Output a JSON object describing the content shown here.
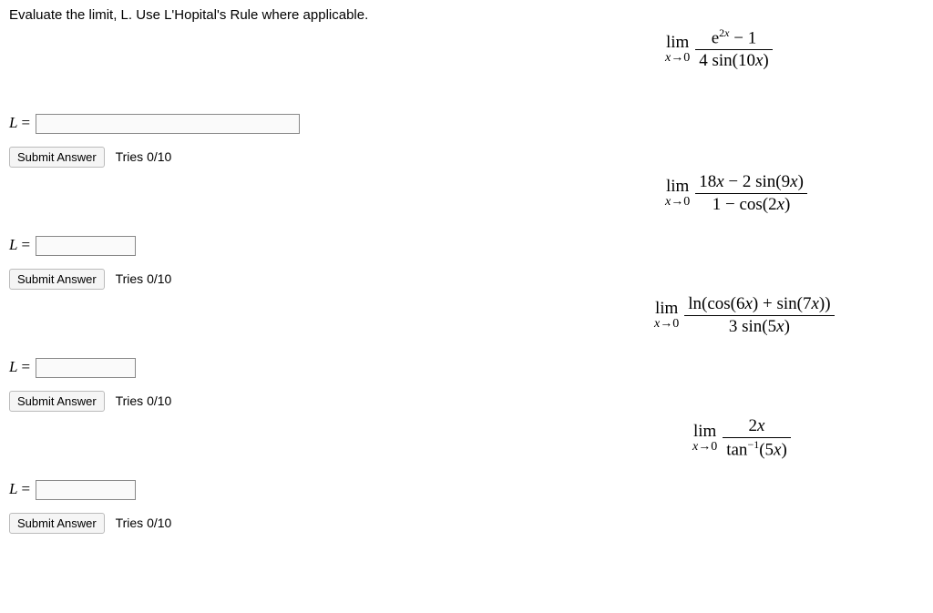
{
  "prompt": "Evaluate the limit, L. Use L'Hopital's Rule where applicable.",
  "label_L": "L",
  "label_eq": "=",
  "submit_label": "Submit Answer",
  "tries_label": "Tries 0/10",
  "lim_text": "lim",
  "approach": "x→0",
  "p1": {
    "num_html": "e<span class='sup'>2<span class='it'>x</span></span> − 1",
    "den_html": "4 sin(10<span class='it'>x</span>)",
    "input_width": 290
  },
  "p2": {
    "num_html": "18<span class='it'>x</span> − 2 sin(9<span class='it'>x</span>)",
    "den_html": "1 − cos(2<span class='it'>x</span>)",
    "input_width": 110
  },
  "p3": {
    "num_html": "ln(cos(6<span class='it'>x</span>) + sin(7<span class='it'>x</span>))",
    "den_html": "3 sin(5<span class='it'>x</span>)",
    "input_width": 110
  },
  "p4": {
    "num_html": "2<span class='it'>x</span>",
    "den_html": "tan<span class='sup'>−1</span>(5<span class='it'>x</span>)",
    "input_width": 110
  }
}
